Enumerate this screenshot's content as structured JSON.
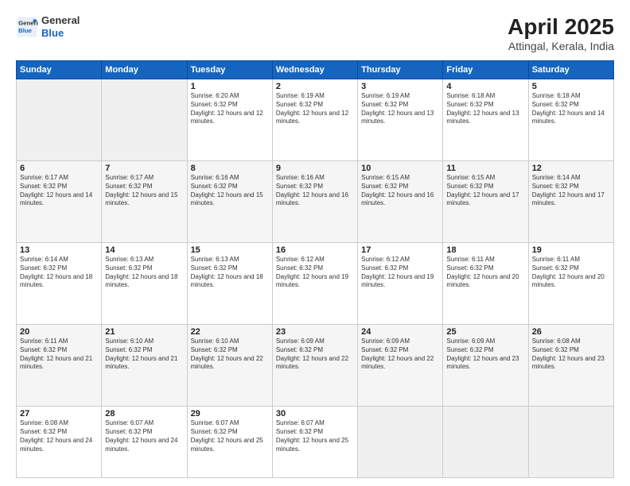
{
  "header": {
    "logo_general": "General",
    "logo_blue": "Blue",
    "title": "April 2025",
    "subtitle": "Attingal, Kerala, India"
  },
  "weekdays": [
    "Sunday",
    "Monday",
    "Tuesday",
    "Wednesday",
    "Thursday",
    "Friday",
    "Saturday"
  ],
  "weeks": [
    [
      {
        "day": "",
        "sunrise": "",
        "sunset": "",
        "daylight": ""
      },
      {
        "day": "",
        "sunrise": "",
        "sunset": "",
        "daylight": ""
      },
      {
        "day": "1",
        "sunrise": "Sunrise: 6:20 AM",
        "sunset": "Sunset: 6:32 PM",
        "daylight": "Daylight: 12 hours and 12 minutes."
      },
      {
        "day": "2",
        "sunrise": "Sunrise: 6:19 AM",
        "sunset": "Sunset: 6:32 PM",
        "daylight": "Daylight: 12 hours and 12 minutes."
      },
      {
        "day": "3",
        "sunrise": "Sunrise: 6:19 AM",
        "sunset": "Sunset: 6:32 PM",
        "daylight": "Daylight: 12 hours and 13 minutes."
      },
      {
        "day": "4",
        "sunrise": "Sunrise: 6:18 AM",
        "sunset": "Sunset: 6:32 PM",
        "daylight": "Daylight: 12 hours and 13 minutes."
      },
      {
        "day": "5",
        "sunrise": "Sunrise: 6:18 AM",
        "sunset": "Sunset: 6:32 PM",
        "daylight": "Daylight: 12 hours and 14 minutes."
      }
    ],
    [
      {
        "day": "6",
        "sunrise": "Sunrise: 6:17 AM",
        "sunset": "Sunset: 6:32 PM",
        "daylight": "Daylight: 12 hours and 14 minutes."
      },
      {
        "day": "7",
        "sunrise": "Sunrise: 6:17 AM",
        "sunset": "Sunset: 6:32 PM",
        "daylight": "Daylight: 12 hours and 15 minutes."
      },
      {
        "day": "8",
        "sunrise": "Sunrise: 6:16 AM",
        "sunset": "Sunset: 6:32 PM",
        "daylight": "Daylight: 12 hours and 15 minutes."
      },
      {
        "day": "9",
        "sunrise": "Sunrise: 6:16 AM",
        "sunset": "Sunset: 6:32 PM",
        "daylight": "Daylight: 12 hours and 16 minutes."
      },
      {
        "day": "10",
        "sunrise": "Sunrise: 6:15 AM",
        "sunset": "Sunset: 6:32 PM",
        "daylight": "Daylight: 12 hours and 16 minutes."
      },
      {
        "day": "11",
        "sunrise": "Sunrise: 6:15 AM",
        "sunset": "Sunset: 6:32 PM",
        "daylight": "Daylight: 12 hours and 17 minutes."
      },
      {
        "day": "12",
        "sunrise": "Sunrise: 6:14 AM",
        "sunset": "Sunset: 6:32 PM",
        "daylight": "Daylight: 12 hours and 17 minutes."
      }
    ],
    [
      {
        "day": "13",
        "sunrise": "Sunrise: 6:14 AM",
        "sunset": "Sunset: 6:32 PM",
        "daylight": "Daylight: 12 hours and 18 minutes."
      },
      {
        "day": "14",
        "sunrise": "Sunrise: 6:13 AM",
        "sunset": "Sunset: 6:32 PM",
        "daylight": "Daylight: 12 hours and 18 minutes."
      },
      {
        "day": "15",
        "sunrise": "Sunrise: 6:13 AM",
        "sunset": "Sunset: 6:32 PM",
        "daylight": "Daylight: 12 hours and 18 minutes."
      },
      {
        "day": "16",
        "sunrise": "Sunrise: 6:12 AM",
        "sunset": "Sunset: 6:32 PM",
        "daylight": "Daylight: 12 hours and 19 minutes."
      },
      {
        "day": "17",
        "sunrise": "Sunrise: 6:12 AM",
        "sunset": "Sunset: 6:32 PM",
        "daylight": "Daylight: 12 hours and 19 minutes."
      },
      {
        "day": "18",
        "sunrise": "Sunrise: 6:11 AM",
        "sunset": "Sunset: 6:32 PM",
        "daylight": "Daylight: 12 hours and 20 minutes."
      },
      {
        "day": "19",
        "sunrise": "Sunrise: 6:11 AM",
        "sunset": "Sunset: 6:32 PM",
        "daylight": "Daylight: 12 hours and 20 minutes."
      }
    ],
    [
      {
        "day": "20",
        "sunrise": "Sunrise: 6:11 AM",
        "sunset": "Sunset: 6:32 PM",
        "daylight": "Daylight: 12 hours and 21 minutes."
      },
      {
        "day": "21",
        "sunrise": "Sunrise: 6:10 AM",
        "sunset": "Sunset: 6:32 PM",
        "daylight": "Daylight: 12 hours and 21 minutes."
      },
      {
        "day": "22",
        "sunrise": "Sunrise: 6:10 AM",
        "sunset": "Sunset: 6:32 PM",
        "daylight": "Daylight: 12 hours and 22 minutes."
      },
      {
        "day": "23",
        "sunrise": "Sunrise: 6:09 AM",
        "sunset": "Sunset: 6:32 PM",
        "daylight": "Daylight: 12 hours and 22 minutes."
      },
      {
        "day": "24",
        "sunrise": "Sunrise: 6:09 AM",
        "sunset": "Sunset: 6:32 PM",
        "daylight": "Daylight: 12 hours and 22 minutes."
      },
      {
        "day": "25",
        "sunrise": "Sunrise: 6:09 AM",
        "sunset": "Sunset: 6:32 PM",
        "daylight": "Daylight: 12 hours and 23 minutes."
      },
      {
        "day": "26",
        "sunrise": "Sunrise: 6:08 AM",
        "sunset": "Sunset: 6:32 PM",
        "daylight": "Daylight: 12 hours and 23 minutes."
      }
    ],
    [
      {
        "day": "27",
        "sunrise": "Sunrise: 6:08 AM",
        "sunset": "Sunset: 6:32 PM",
        "daylight": "Daylight: 12 hours and 24 minutes."
      },
      {
        "day": "28",
        "sunrise": "Sunrise: 6:07 AM",
        "sunset": "Sunset: 6:32 PM",
        "daylight": "Daylight: 12 hours and 24 minutes."
      },
      {
        "day": "29",
        "sunrise": "Sunrise: 6:07 AM",
        "sunset": "Sunset: 6:32 PM",
        "daylight": "Daylight: 12 hours and 25 minutes."
      },
      {
        "day": "30",
        "sunrise": "Sunrise: 6:07 AM",
        "sunset": "Sunset: 6:32 PM",
        "daylight": "Daylight: 12 hours and 25 minutes."
      },
      {
        "day": "",
        "sunrise": "",
        "sunset": "",
        "daylight": ""
      },
      {
        "day": "",
        "sunrise": "",
        "sunset": "",
        "daylight": ""
      },
      {
        "day": "",
        "sunrise": "",
        "sunset": "",
        "daylight": ""
      }
    ]
  ]
}
